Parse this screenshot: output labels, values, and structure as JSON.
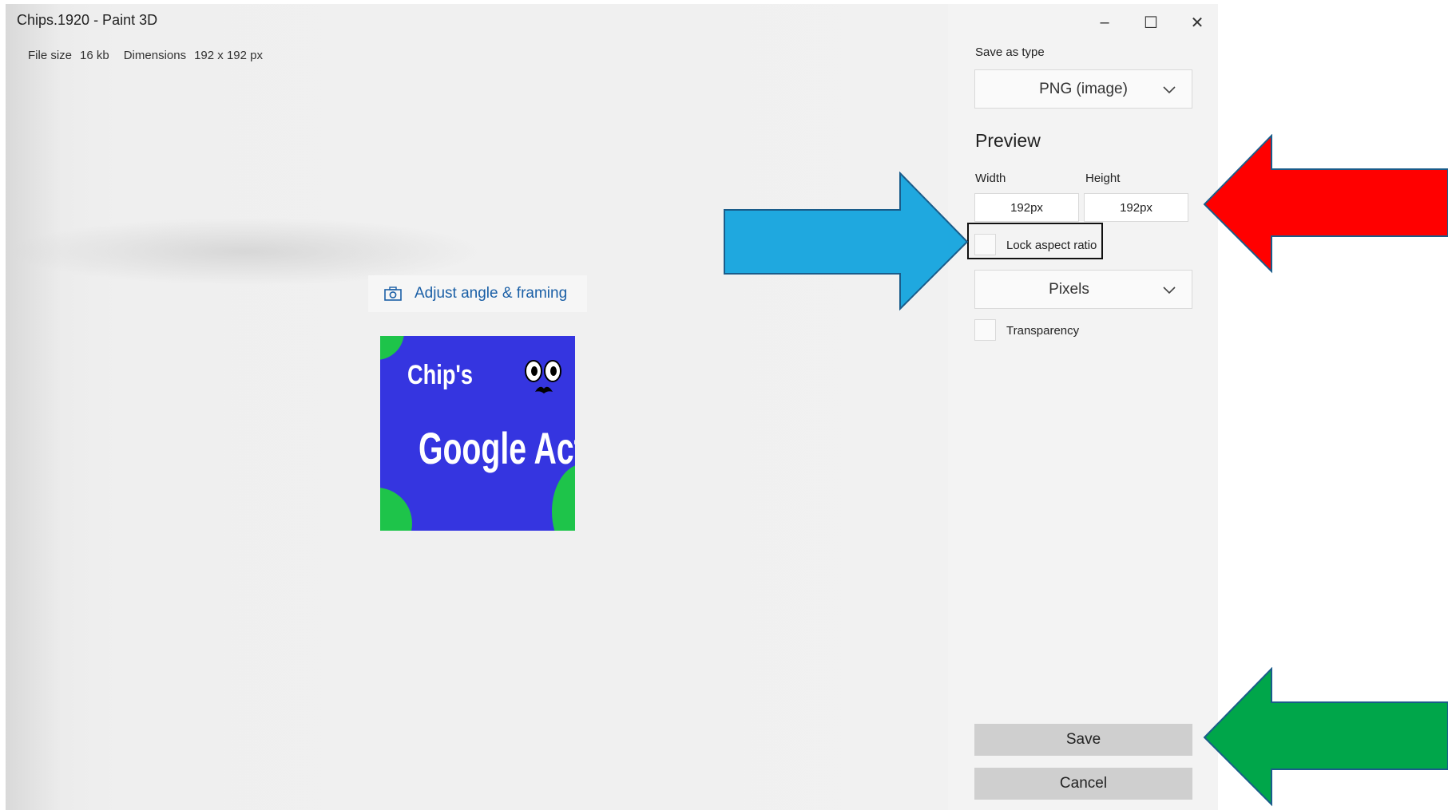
{
  "window": {
    "title": "Chips.1920 - Paint 3D",
    "controls": {
      "minimize": "–",
      "maximize": "☐",
      "close": "✕"
    }
  },
  "file_info": {
    "size_label": "File size",
    "size_value": "16 kb",
    "dims_label": "Dimensions",
    "dims_value": "192 x 192 px"
  },
  "canvas": {
    "adjust_button": "Adjust angle & framing",
    "thumbnail": {
      "title_text": "Chip's",
      "main_text": "Google Action"
    }
  },
  "panel": {
    "save_as_type_label": "Save as type",
    "save_as_type_value": "PNG (image)",
    "preview_heading": "Preview",
    "width_label": "Width",
    "height_label": "Height",
    "width_value": "192px",
    "height_value": "192px",
    "lock_aspect_label": "Lock aspect ratio",
    "units_value": "Pixels",
    "transparency_label": "Transparency",
    "save_button": "Save",
    "cancel_button": "Cancel"
  },
  "annotations": {
    "blue_arrow_color": "#1fa8df",
    "red_arrow_color": "#ff0000",
    "green_arrow_color": "#00a64a"
  }
}
